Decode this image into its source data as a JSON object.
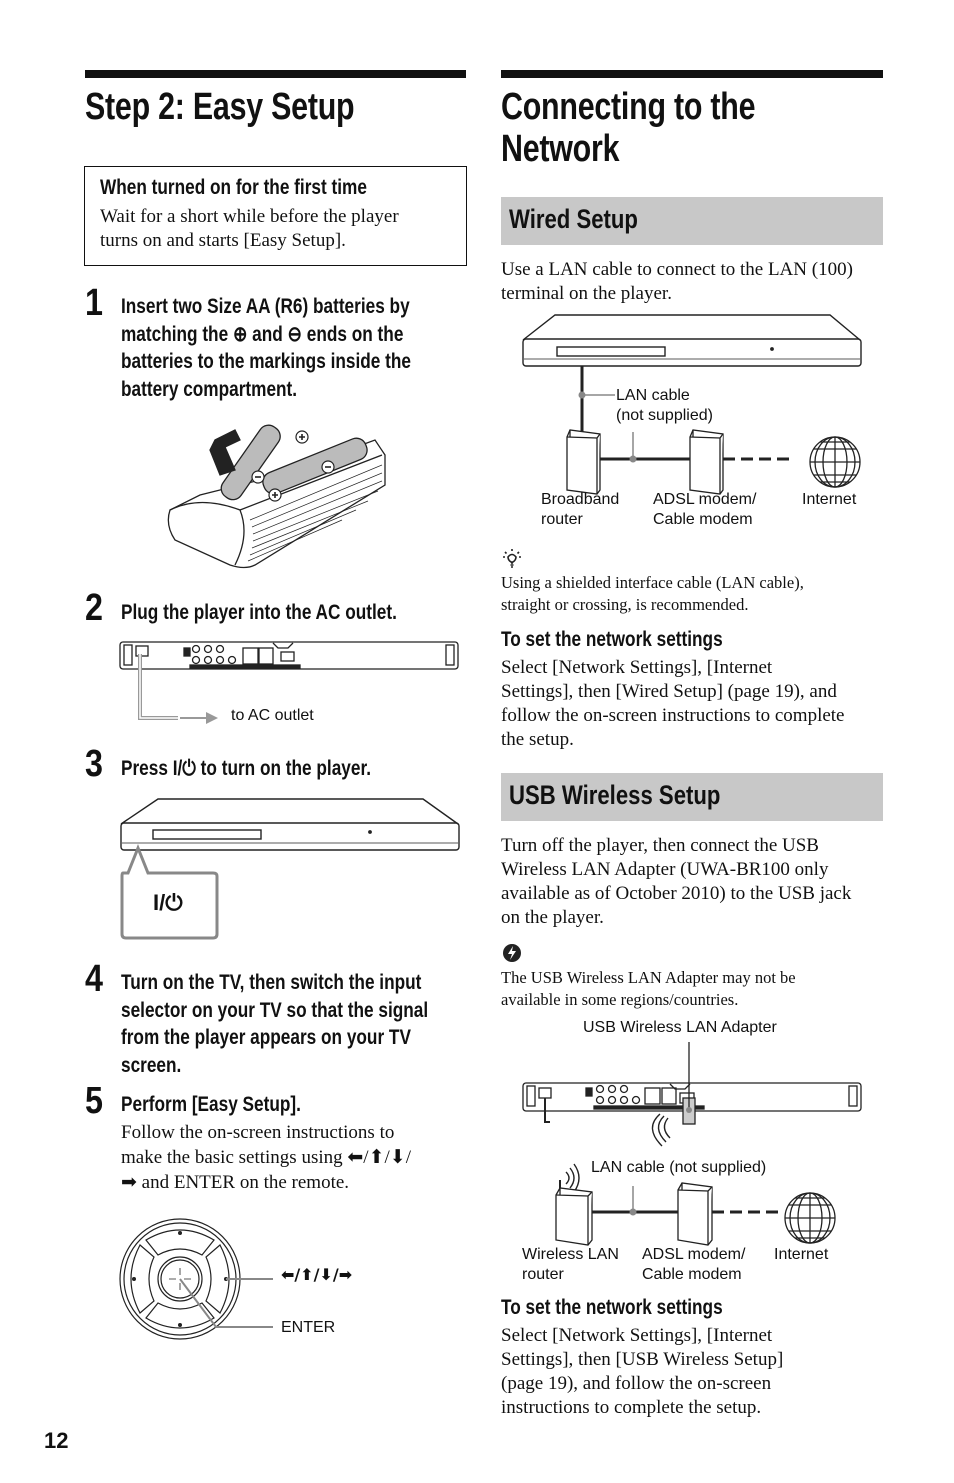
{
  "left": {
    "title": "Step 2: Easy Setup",
    "first_time_box": {
      "title": "When turned on for the first time",
      "lines": [
        "Wait for a short while before the player",
        "turns on and starts [Easy Setup]."
      ]
    },
    "steps": [
      {
        "number": "1",
        "lines": [
          "Insert two Size AA (R6) batteries by",
          "matching the ⊕ and ⊖ ends on the",
          "batteries to the markings inside the",
          "battery compartment."
        ]
      },
      {
        "number": "2",
        "lines": [
          "Plug the player into the AC outlet."
        ]
      },
      {
        "number": "3",
        "lines": [
          "Press I/⏻ to turn on the player."
        ]
      },
      {
        "number": "4",
        "lines": [
          "Turn on the TV, then switch the input",
          "selector on your TV so that the signal",
          "from the player appears on your TV",
          "screen."
        ]
      },
      {
        "number": "5",
        "lines": [
          "Perform [Easy Setup]."
        ],
        "body": [
          "Follow the on-screen instructions to",
          "make the basic settings using ⬅/⬆/⬇/",
          "➡ and ENTER on the remote."
        ]
      }
    ],
    "figures": {
      "ac_outlet_label": "to AC outlet",
      "power_button_label": "I/⏻",
      "remote_arrows_label": "⬅/⬆/⬇/➡",
      "remote_enter_label": "ENTER"
    }
  },
  "right": {
    "title_lines": [
      "Connecting to the",
      "Network"
    ],
    "wired": {
      "heading": "Wired Setup",
      "intro": [
        "Use a LAN cable to connect to the LAN (100)",
        "terminal on the player."
      ],
      "diagram": {
        "cable_label": [
          "LAN cable",
          "(not supplied)"
        ],
        "router_label": [
          "Broadband",
          "router"
        ],
        "modem_label": [
          "ADSL modem/",
          "Cable modem"
        ],
        "internet_label": "Internet"
      },
      "hint_icon": "lightbulb-hint-icon",
      "hint": [
        "Using a shielded interface cable (LAN cable),",
        "straight or crossing, is recommended."
      ],
      "settings_title": "To set the network settings",
      "settings_body": [
        "Select [Network Settings], [Internet",
        "Settings], then [Wired Setup] (page 19), and",
        "follow the on-screen instructions to complete",
        "the setup."
      ]
    },
    "usb": {
      "heading": "USB Wireless Setup",
      "intro": [
        "Turn off the player, then connect the USB",
        "Wireless LAN Adapter (UWA-BR100 only",
        "available as of October 2010) to the USB jack",
        "on the player."
      ],
      "note_icon": "caution-note-icon",
      "note": [
        "The USB Wireless LAN Adapter may not be",
        "available in some regions/countries."
      ],
      "diagram": {
        "adapter_label": "USB Wireless LAN Adapter",
        "cable_label": "LAN cable (not supplied)",
        "router_label": [
          "Wireless LAN",
          "router"
        ],
        "modem_label": [
          "ADSL modem/",
          "Cable modem"
        ],
        "internet_label": "Internet"
      },
      "settings_title": "To set the network settings",
      "settings_body": [
        "Select [Network Settings], [Internet",
        "Settings], then [USB Wireless Setup]",
        "(page 19), and follow the on-screen",
        "instructions to complete the setup."
      ]
    }
  },
  "page_number": "12"
}
